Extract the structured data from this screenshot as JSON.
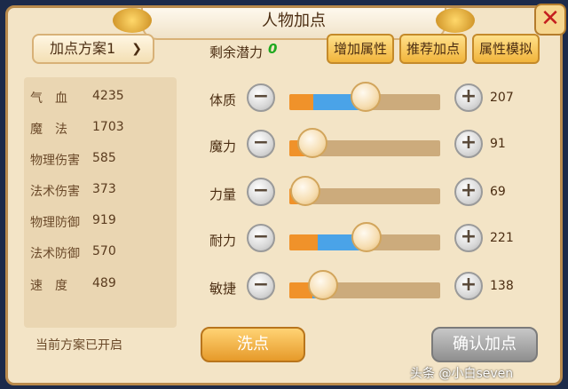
{
  "window": {
    "title": "人物加点"
  },
  "close_icon": "close-x-icon",
  "scheme": {
    "selected": "加点方案1",
    "status": "当前方案已开启"
  },
  "stats": [
    {
      "label": "气　血",
      "value": "4235"
    },
    {
      "label": "魔　法",
      "value": "1703"
    },
    {
      "label": "物理伤害",
      "value": "585"
    },
    {
      "label": "法术伤害",
      "value": "373"
    },
    {
      "label": "物理防御",
      "value": "919"
    },
    {
      "label": "法术防御",
      "value": "570"
    },
    {
      "label": "速　度",
      "value": "489"
    }
  ],
  "potential": {
    "label": "剩余潜力",
    "value": "0"
  },
  "top_buttons": {
    "add": "增加属性",
    "recommend": "推荐加点",
    "simulate": "属性模拟"
  },
  "attributes": [
    {
      "name": "体质",
      "value": "207",
      "base_fraction": 0.16,
      "added_fraction": 0.32
    },
    {
      "name": "魔力",
      "value": "91",
      "base_fraction": 0.13,
      "added_fraction": 0.0
    },
    {
      "name": "力量",
      "value": "69",
      "base_fraction": 0.08,
      "added_fraction": 0.0
    },
    {
      "name": "耐力",
      "value": "221",
      "base_fraction": 0.19,
      "added_fraction": 0.3
    },
    {
      "name": "敏捷",
      "value": "138",
      "base_fraction": 0.15,
      "added_fraction": 0.05
    }
  ],
  "buttons": {
    "wash": "洗点",
    "confirm": "确认加点"
  },
  "watermark": "头条 @小白seven",
  "colors": {
    "base_bar": "#f0922a",
    "added_bar": "#4aa3e8",
    "potential": "#1fa81f"
  }
}
